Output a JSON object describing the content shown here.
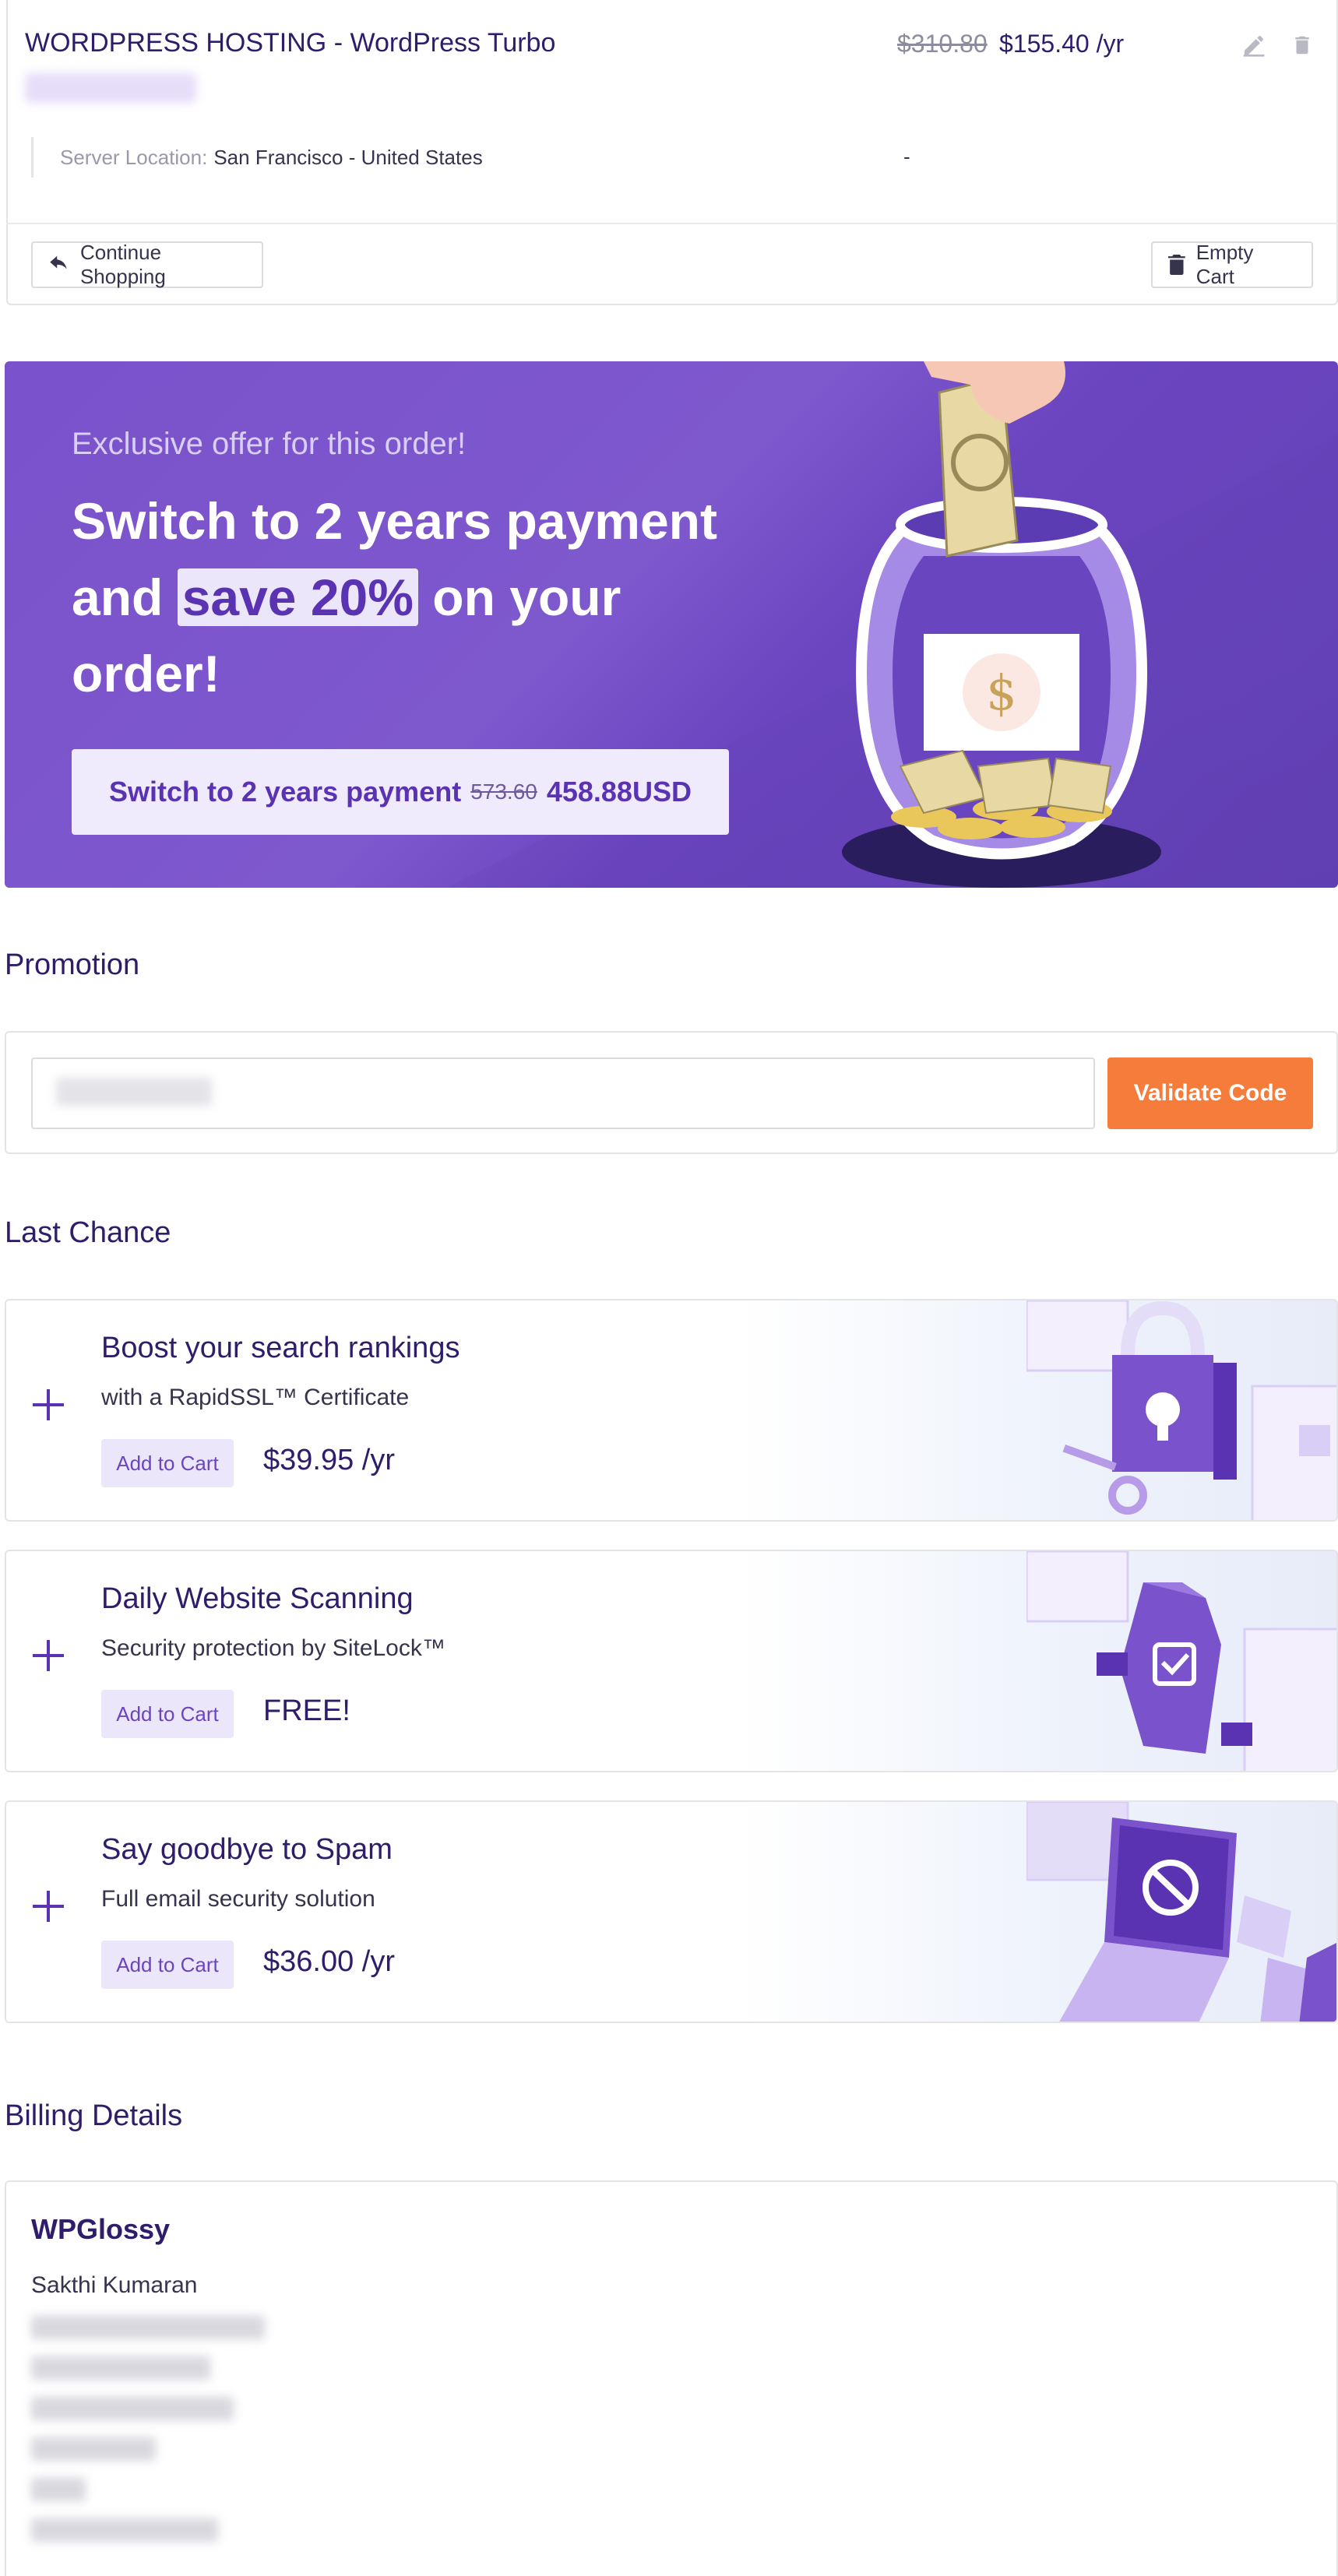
{
  "cart_item": {
    "title": "WORDPRESS HOSTING - WordPress Turbo",
    "old_price": "$310.80",
    "new_price": "$155.40 /yr",
    "location_label": "Server Location:",
    "location_value": "San Francisco - United States",
    "location_price": "-"
  },
  "cart_actions": {
    "continue_label": "Continue Shopping",
    "empty_label": "Empty Cart"
  },
  "offer": {
    "kicker": "Exclusive offer for this order!",
    "headline_pre": "Switch to 2 years payment and",
    "headline_highlight": "save 20%",
    "headline_post": "on your order!",
    "button_label": "Switch to 2 years payment",
    "button_old_price": "573.60",
    "button_new_price": "458.88USD"
  },
  "promotion": {
    "title": "Promotion",
    "validate_label": "Validate Code"
  },
  "last_chance": {
    "title": "Last Chance",
    "add_label": "Add to Cart",
    "items": [
      {
        "title": "Boost your search rankings",
        "subtitle": "with a RapidSSL™ Certificate",
        "price": "$39.95 /yr"
      },
      {
        "title": "Daily Website Scanning",
        "subtitle": "Security protection by SiteLock™",
        "price": "FREE!"
      },
      {
        "title": "Say goodbye to Spam",
        "subtitle": "Full email security solution",
        "price": "$36.00 /yr"
      }
    ]
  },
  "billing": {
    "title": "Billing Details",
    "company": "WPGlossy",
    "name": "Sakthi Kumaran"
  },
  "colors": {
    "accent_purple": "#7a52cc",
    "orange": "#f57c3b",
    "text_dark": "#2f1c6a"
  }
}
